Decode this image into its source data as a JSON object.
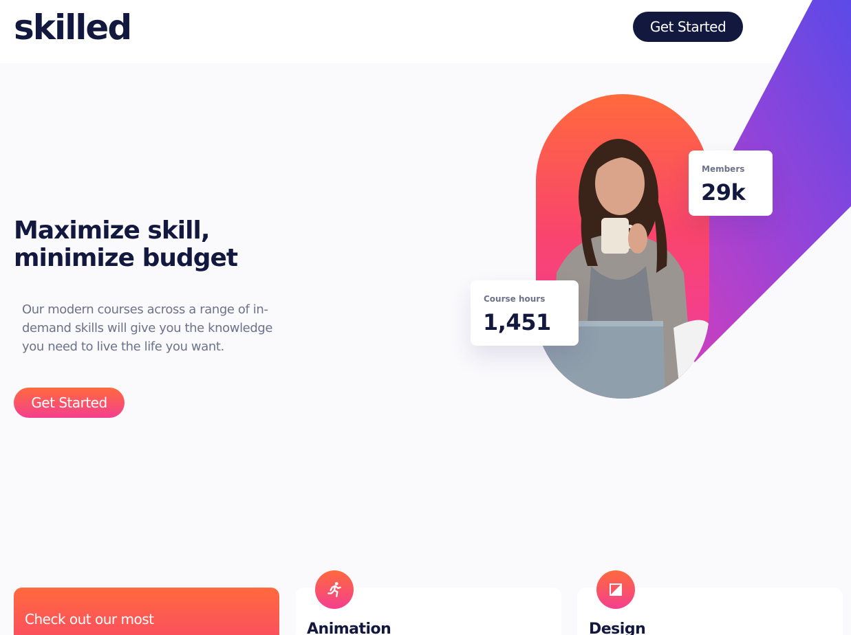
{
  "brand": {
    "logo_text": "skilled"
  },
  "header": {
    "cta_label": "Get Started"
  },
  "hero": {
    "title_line1": "Maximize skill,",
    "title_line2": "minimize budget",
    "description": "Our modern courses across a range of in-demand skills will give you the knowledge you need to live the life you want.",
    "cta_label": "Get Started"
  },
  "stats": [
    {
      "label": "Members",
      "value": "29k"
    },
    {
      "label": "Course hours",
      "value": "1,451"
    }
  ],
  "promo": {
    "text": "Check out our most"
  },
  "courses": [
    {
      "title": "Animation",
      "icon": "running-figure-icon"
    },
    {
      "title": "Design",
      "icon": "image-frame-icon"
    }
  ],
  "colors": {
    "navy": "#13183f",
    "orange": "#ff6a3d",
    "pink": "#f43f8e",
    "purple": "#6a4ae8",
    "grey_text": "#6c7289",
    "page_bg": "#fafafc"
  }
}
